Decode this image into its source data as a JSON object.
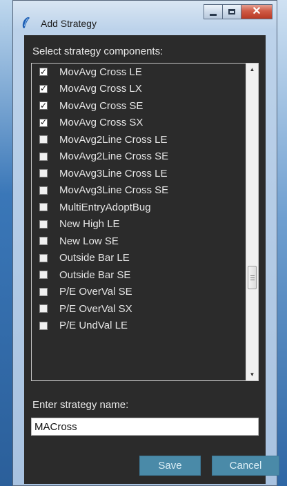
{
  "window": {
    "title": "Add Strategy"
  },
  "components_label": "Select strategy components:",
  "components": [
    {
      "label": "MovAvg Cross LE",
      "checked": true
    },
    {
      "label": "MovAvg Cross LX",
      "checked": true
    },
    {
      "label": "MovAvg Cross SE",
      "checked": true
    },
    {
      "label": "MovAvg Cross SX",
      "checked": true
    },
    {
      "label": "MovAvg2Line Cross LE",
      "checked": false
    },
    {
      "label": "MovAvg2Line Cross SE",
      "checked": false
    },
    {
      "label": "MovAvg3Line Cross LE",
      "checked": false
    },
    {
      "label": "MovAvg3Line Cross SE",
      "checked": false
    },
    {
      "label": "MultiEntryAdoptBug",
      "checked": false
    },
    {
      "label": "New High LE",
      "checked": false
    },
    {
      "label": "New Low SE",
      "checked": false
    },
    {
      "label": "Outside Bar LE",
      "checked": false
    },
    {
      "label": "Outside Bar SE",
      "checked": false
    },
    {
      "label": "P/E OverVal SE",
      "checked": false
    },
    {
      "label": "P/E OverVal SX",
      "checked": false
    },
    {
      "label": "P/E UndVal LE",
      "checked": false
    }
  ],
  "name_label": "Enter strategy name:",
  "name_value": "MACross",
  "buttons": {
    "save": "Save",
    "cancel": "Cancel"
  },
  "colors": {
    "panel_bg": "#2b2b2b",
    "button_bg": "#4a8aa8",
    "close_red": "#c8412b"
  }
}
